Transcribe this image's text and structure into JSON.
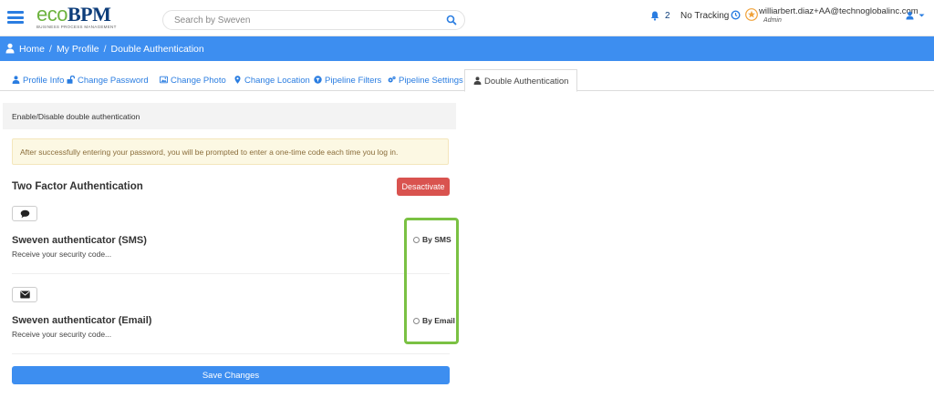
{
  "header": {
    "logo_eco": "eco",
    "logo_bpm": "BPM",
    "logo_tagline": "BUSINESS PROCESS MANAGEMENT",
    "search_placeholder": "Search by Sweven",
    "notification_count": "2",
    "tracking_label": "No Tracking",
    "user_email": "williarbert.diaz+AA@technoglobalinc.com",
    "user_role": "Admin"
  },
  "breadcrumb": {
    "home": "Home",
    "my_profile": "My Profile",
    "current": "Double Authentication"
  },
  "tabs": [
    {
      "label": "Profile Info",
      "icon": "user-icon"
    },
    {
      "label": "Change Password",
      "icon": "unlock-icon"
    },
    {
      "label": "Change Photo",
      "icon": "image-icon"
    },
    {
      "label": "Change Location",
      "icon": "map-marker-icon"
    },
    {
      "label": "Pipeline Filters",
      "icon": "filter-icon"
    },
    {
      "label": "Pipeline Settings",
      "icon": "gears-icon"
    },
    {
      "label": "Double Authentication",
      "icon": "user-icon",
      "active": true
    }
  ],
  "panel": {
    "title": "Enable/Disable double authentication",
    "alert": "After successfully entering your password, you will be prompted to enter a one-time code each time you log in.",
    "tfa_title": "Two Factor Authentication",
    "deactivate_label": "Desactivate",
    "methods": [
      {
        "title": "Sweven authenticator (SMS)",
        "subtitle": "Receive your security code...",
        "option_label": "By SMS",
        "icon": "comment-icon",
        "selected": false
      },
      {
        "title": "Sweven authenticator (Email)",
        "subtitle": "Receive your security code...",
        "option_label": "By Email",
        "icon": "envelope-icon",
        "selected": false
      }
    ],
    "save_label": "Save Changes"
  },
  "colors": {
    "primary": "#3d8ef0",
    "danger": "#d9534f",
    "highlight": "#7ac143",
    "alert_bg": "#fcf8e3"
  }
}
